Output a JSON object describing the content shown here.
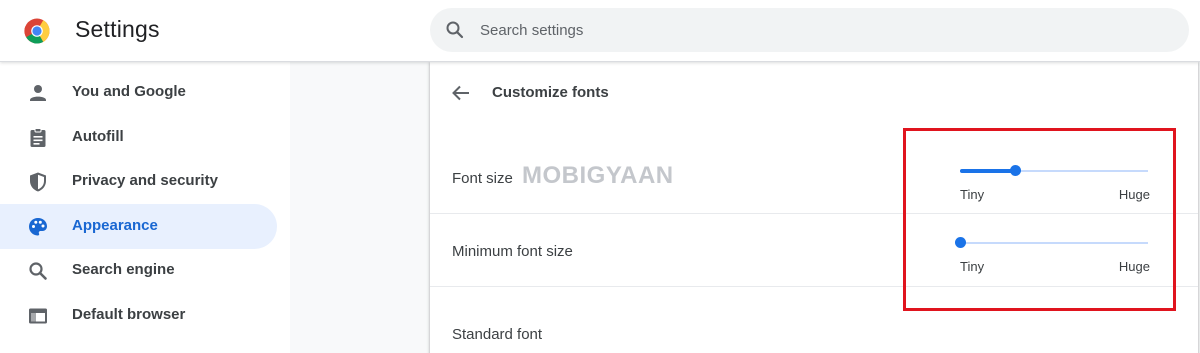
{
  "app": {
    "title": "Settings",
    "logo_icon": "chrome-logo-icon"
  },
  "search": {
    "placeholder": "Search settings",
    "value": "",
    "icon": "search-icon"
  },
  "sidebar": {
    "items": [
      {
        "label": "You and Google",
        "icon": "person-icon",
        "active": false
      },
      {
        "label": "Autofill",
        "icon": "clipboard-icon",
        "active": false
      },
      {
        "label": "Privacy and security",
        "icon": "shield-icon",
        "active": false
      },
      {
        "label": "Appearance",
        "icon": "palette-icon",
        "active": true
      },
      {
        "label": "Search engine",
        "icon": "magnifier-icon",
        "active": false
      },
      {
        "label": "Default browser",
        "icon": "browser-window-icon",
        "active": false
      }
    ]
  },
  "main": {
    "back_icon": "back-arrow-icon",
    "title": "Customize fonts",
    "watermark": "MOBIGYAAN",
    "font_size": {
      "label": "Font size",
      "min_label": "Tiny",
      "max_label": "Huge",
      "level": 0.29
    },
    "minimum_font_size": {
      "label": "Minimum font size",
      "min_label": "Tiny",
      "max_label": "Huge",
      "level": 0.0
    },
    "standard_font": {
      "label": "Standard font"
    }
  },
  "colors": {
    "accent": "#1a73e8",
    "active_nav_bg": "#e8f0fe",
    "active_nav_text": "#1967d2",
    "highlight_box": "#e0141e"
  }
}
